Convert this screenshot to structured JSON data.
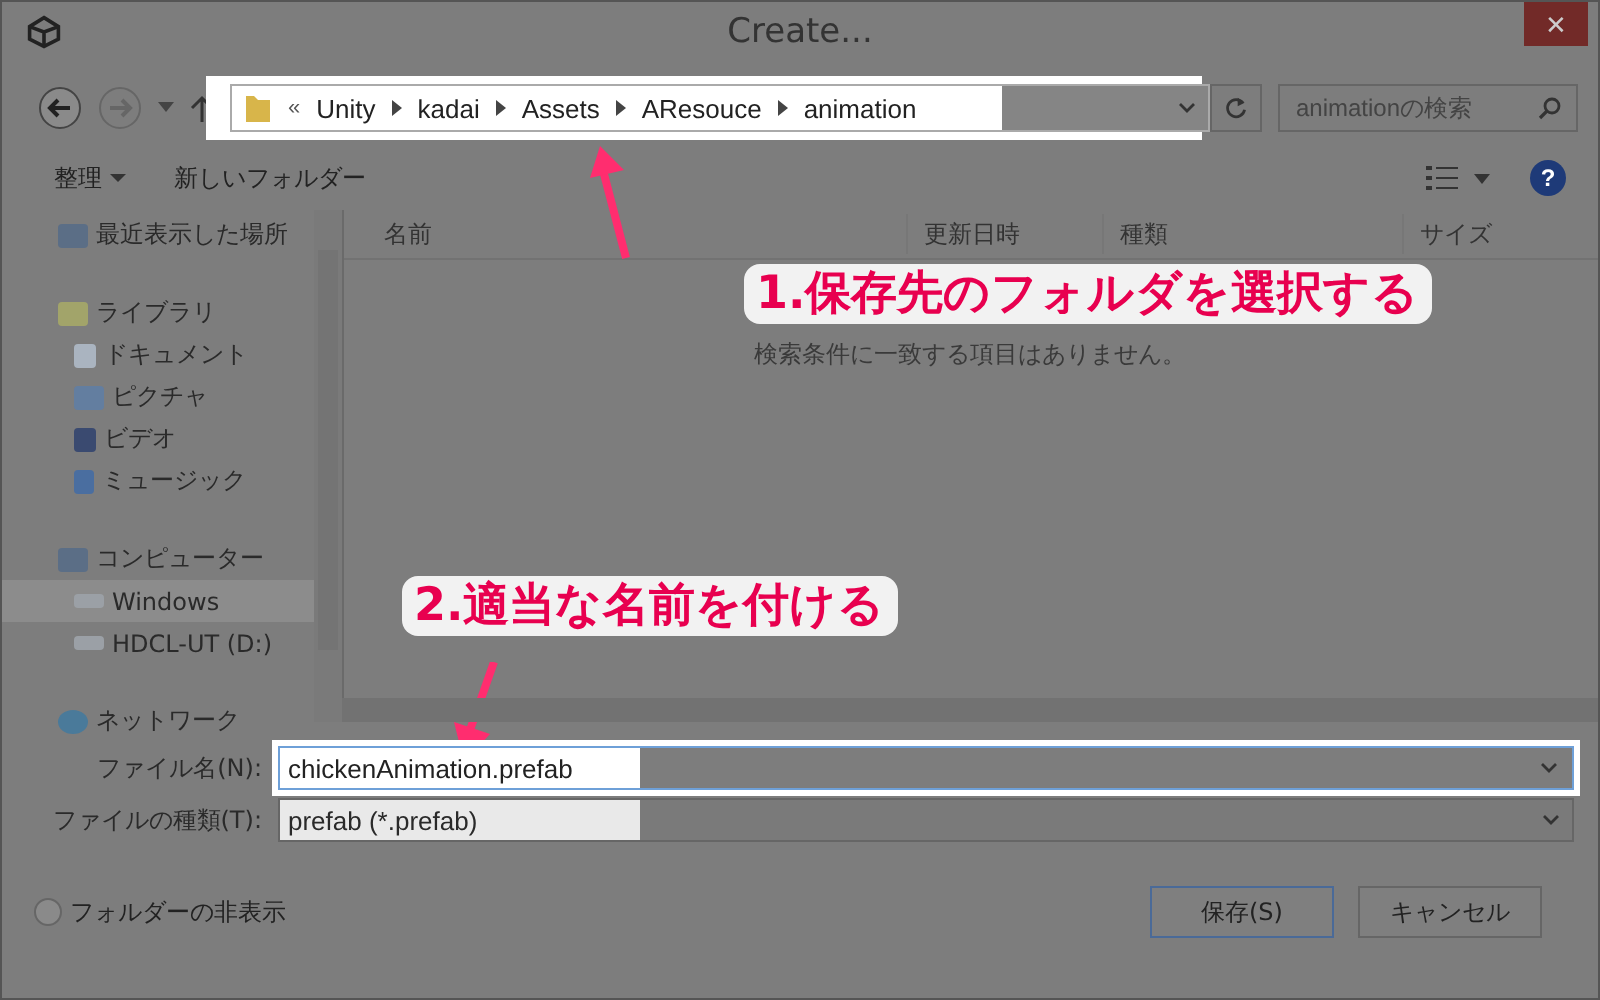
{
  "window": {
    "title": "Create...",
    "close": "✕"
  },
  "nav": {
    "overflow": "«",
    "path": [
      "Unity",
      "kadai",
      "Assets",
      "AResouce",
      "animation"
    ],
    "search": {
      "placeholder": "animationの検索"
    }
  },
  "toolbar": {
    "organize": "整理",
    "new_folder": "新しいフォルダー",
    "help": "?"
  },
  "sidebar": {
    "items": [
      {
        "label": "最近表示した場所",
        "kind": "recent",
        "selected": false
      },
      {
        "label": "ライブラリ",
        "kind": "library",
        "selected": false,
        "children": [
          {
            "label": "ドキュメント",
            "kind": "document",
            "selected": false
          },
          {
            "label": "ピクチャ",
            "kind": "picture",
            "selected": false
          },
          {
            "label": "ビデオ",
            "kind": "video",
            "selected": false
          },
          {
            "label": "ミュージック",
            "kind": "music",
            "selected": false
          }
        ]
      },
      {
        "label": "コンピューター",
        "kind": "computer",
        "selected": false,
        "children": [
          {
            "label": "Windows",
            "kind": "drive",
            "selected": true
          },
          {
            "label": "HDCL-UT (D:)",
            "kind": "drive",
            "selected": false
          }
        ]
      },
      {
        "label": "ネットワーク",
        "kind": "network",
        "selected": false
      }
    ]
  },
  "table": {
    "columns": [
      "名前",
      "更新日時",
      "種類",
      "サイズ"
    ],
    "empty_message": "検索条件に一致する項目はありません。"
  },
  "form": {
    "filename_label": "ファイル名(N):",
    "filename": "chickenAnimation.prefab",
    "filetype_label": "ファイルの種類(T):",
    "filetype": "prefab (*.prefab)"
  },
  "footer": {
    "hide_folders": "フォルダーの非表示",
    "buttons": [
      "保存(S)",
      "キャンセル"
    ]
  },
  "annotations": [
    "1.保存先のフォルダを選択する",
    "2.適当な名前を付ける"
  ]
}
